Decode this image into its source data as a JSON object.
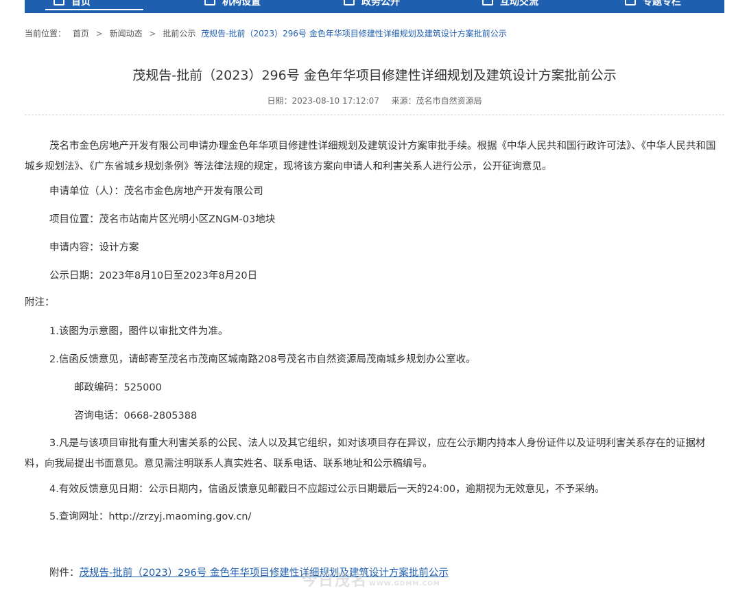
{
  "nav": {
    "items": [
      {
        "label": "首页",
        "icon": "home-icon"
      },
      {
        "label": "机构设置",
        "icon": "building-icon"
      },
      {
        "label": "政务公开",
        "icon": "document-icon"
      },
      {
        "label": "互动交流",
        "icon": "chat-icon"
      },
      {
        "label": "专题专栏",
        "icon": "bookmark-icon"
      }
    ],
    "accent": "#1f5fb0"
  },
  "breadcrumb": {
    "prefix": "当前位置：",
    "items": [
      "首页",
      "新闻动态",
      "批前公示"
    ],
    "current": "茂规告-批前（2023）296号 金色年华项目修建性详细规划及建筑设计方案批前公示"
  },
  "article": {
    "title": "茂规告-批前（2023）296号 金色年华项目修建性详细规划及建筑设计方案批前公示",
    "date": "日期：2023-08-10 17:12:07",
    "source": "来源：茂名市自然资源局",
    "intro": "茂名市金色房地产开发有限公司申请办理金色年华项目修建性详细规划及建筑设计方案审批手续。根据《中华人民共和国行政许可法》、《中华人民共和国城乡规划法》、《广东省城乡规划条例》等法律法规的规定，现将该方案向申请人和利害关系人进行公示，公开征询意见。",
    "applicant": "申请单位（人）：茂名市金色房地产开发有限公司",
    "location": "项目位置：茂名市站南片区光明小区ZNGM-03地块",
    "content": "申请内容：设计方案",
    "period": "公示日期：2023年8月10日至2023年8月20日",
    "notes_label": "附注：",
    "note1": "1.该图为示意图，图件以审批文件为准。",
    "note2": "2.信函反馈意见，请邮寄至茂名市茂南区城南路208号茂名市自然资源局茂南城乡规划办公室收。",
    "postcode": "邮政编码：525000",
    "phone": "咨询电话：0668-2805388",
    "note3": "3.凡是与该项目审批有重大利害关系的公民、法人以及其它组织，如对该项目存在异议，应在公示期内持本人身份证件以及证明利害关系存在的证据材料，向我局提出书面意见。意见需注明联系人真实姓名、联系电话、联系地址和公示稿编号。",
    "note4": "4.有效反馈意见日期：公示日期内，信函反馈意见邮戳日不应超过公示日期最后一天的24:00，逾期视为无效意见，不予采纳。",
    "note5": "5.查询网址：http://zrzyj.maoming.gov.cn/",
    "attachment_label": "附件：",
    "attachment_link": "茂规告-批前（2023）296号 金色年华项目修建性详细规划及建筑设计方案批前公示"
  },
  "watermark": {
    "text": "今日茂名",
    "sub": "WWW.GDMM.COM"
  }
}
